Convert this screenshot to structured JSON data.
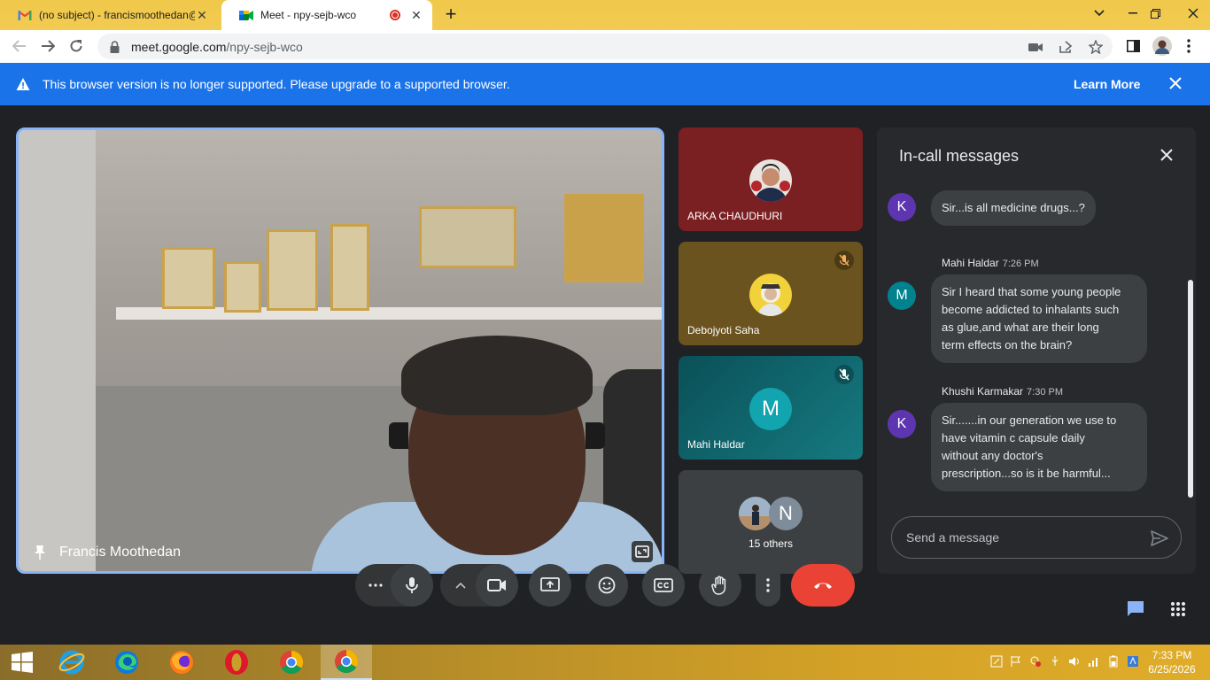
{
  "browser": {
    "tabs": [
      {
        "title": "(no subject) - francismoothedan@",
        "icon": "gmail-icon",
        "active": false
      },
      {
        "title": "Meet - npy-sejb-wco",
        "icon": "meet-icon",
        "active": true,
        "recording": true
      }
    ],
    "url": {
      "host": "meet.google.com",
      "path": "/npy-sejb-wco"
    }
  },
  "banner": {
    "message": "This browser version is no longer supported. Please upgrade to a supported browser.",
    "learn_more": "Learn More"
  },
  "main_tile": {
    "name": "Francis Moothedan"
  },
  "side_tiles": [
    {
      "name": "ARKA CHAUDHURI",
      "bg": "#7a1f22",
      "muted": false
    },
    {
      "name": "Debojyoti Saha",
      "bg": "#6b5320",
      "muted": true
    },
    {
      "name": "Mahi Haldar",
      "bg": "#0f5c63",
      "avatar_letter": "M",
      "muted": true
    }
  ],
  "others": {
    "label": "15 others",
    "letter": "N"
  },
  "chat": {
    "title": "In-call messages",
    "messages": [
      {
        "avatar": "K",
        "avatar_color": "#5e35b1",
        "sender": "",
        "time": "",
        "text": "Sir...is all medicine drugs...?"
      },
      {
        "avatar": "M",
        "avatar_color": "#00838f",
        "sender": "Mahi Haldar",
        "time": "7:26 PM",
        "lines": [
          "Sir I heard that some young people",
          "become addicted to inhalants such",
          "as glue,and what are their long",
          "term effects on the brain?"
        ]
      },
      {
        "avatar": "K",
        "avatar_color": "#5e35b1",
        "sender": "Khushi Karmakar",
        "time": "7:30 PM",
        "lines": [
          "Sir.......in our generation we use to",
          "have  vitamin c capsule daily",
          "without any doctor's",
          "prescription...so is  it  be harmful..."
        ]
      }
    ],
    "input_placeholder": "Send a message"
  },
  "taskbar": {
    "time": "7:33 PM",
    "date": "6/25/2026"
  },
  "colors": {
    "accent": "#8ab4f8",
    "banner": "#1a73e8",
    "hangup": "#ea4335",
    "chat_bg": "#28292c"
  }
}
